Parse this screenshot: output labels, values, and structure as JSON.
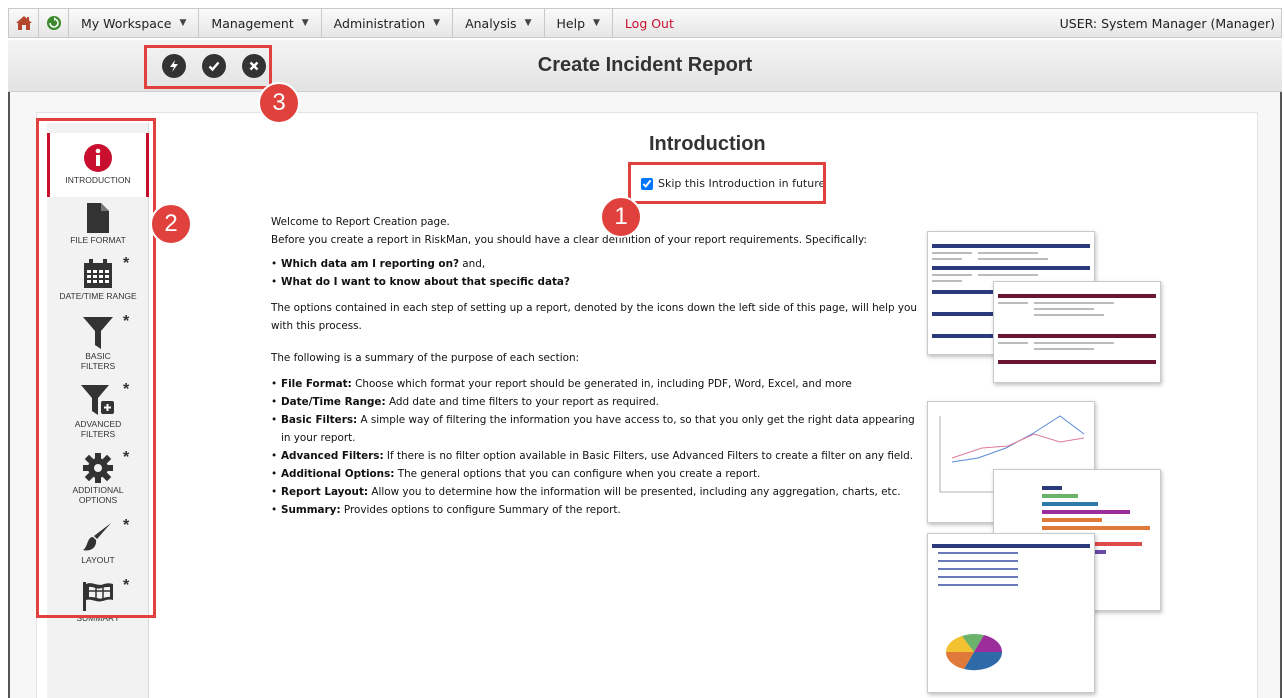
{
  "menu": {
    "items": [
      {
        "label": "My Workspace"
      },
      {
        "label": "Management"
      },
      {
        "label": "Administration"
      },
      {
        "label": "Analysis"
      },
      {
        "label": "Help"
      }
    ],
    "logout": "Log Out",
    "user": "USER: System Manager (Manager)"
  },
  "header": {
    "title": "Create Incident Report"
  },
  "callouts": {
    "one": "1",
    "two": "2",
    "three": "3"
  },
  "sidebar": {
    "items": [
      {
        "label": "INTRODUCTION"
      },
      {
        "label": "FILE FORMAT"
      },
      {
        "label": "DATE/TIME RANGE",
        "star": "*"
      },
      {
        "label": "BASIC FILTERS",
        "star": "*"
      },
      {
        "label": "ADVANCED FILTERS",
        "star": "*"
      },
      {
        "label": "ADDITIONAL OPTIONS",
        "star": "*"
      },
      {
        "label": "LAYOUT",
        "star": "*"
      },
      {
        "label": "SUMMARY",
        "star": "*"
      }
    ]
  },
  "intro": {
    "title": "Introduction",
    "skip_label": "Skip this Introduction in future",
    "welcome": "Welcome to Report Creation page.",
    "before": "Before you create a report in RiskMan, you should have a clear definition of your report requirements. Specifically:",
    "q1": "Which data am I reporting on?",
    "q1_suffix": " and,",
    "q2": "What do I want to know about that specific data?",
    "options_text": "The options contained in each step of setting up a report, denoted by the icons down the left side of this page, will help you with this process.",
    "summary_intro": "The following is a summary of the purpose of each section:",
    "sections": [
      {
        "term": "File Format:",
        "desc": " Choose which format your report should be generated in, including PDF, Word, Excel, and more"
      },
      {
        "term": "Date/Time Range:",
        "desc": " Add date and time filters to your report as required."
      },
      {
        "term": "Basic Filters:",
        "desc": " A simple way of filtering the information you have access to, so that you only get the right data appearing in your report."
      },
      {
        "term": "Advanced Filters:",
        "desc": " If there is no filter option available in Basic Filters, use Advanced Filters to create a filter on any field."
      },
      {
        "term": "Additional Options:",
        "desc": " The general options that you can configure when you create a report."
      },
      {
        "term": "Report Layout:",
        "desc": " Allow you to determine how the information will be presented, including any aggregation, charts, etc."
      },
      {
        "term": "Summary:",
        "desc": " Provides options to configure Summary of the report."
      }
    ]
  },
  "colors": {
    "accent": "#c8102e",
    "callout": "#e0413d"
  }
}
